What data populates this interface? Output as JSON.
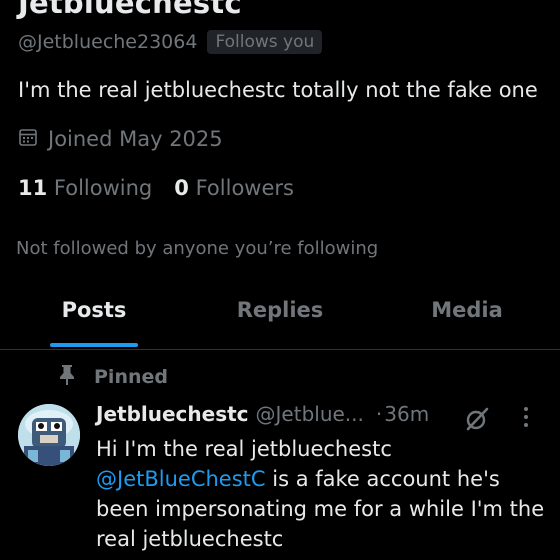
{
  "profile": {
    "display_name": "Jetbluechestc",
    "handle": "@Jetblueche23064",
    "follows_you_label": "Follows you",
    "bio": "I'm the real jetbluechestc totally not the fake one",
    "joined": "Joined May 2025",
    "following_count": "11",
    "following_label": "Following",
    "followers_count": "0",
    "followers_label": "Followers",
    "not_followed_text": "Not followed by anyone you’re following"
  },
  "tabs": [
    {
      "label": "Posts",
      "active": true
    },
    {
      "label": "Replies",
      "active": false
    },
    {
      "label": "Media",
      "active": false
    }
  ],
  "pinned_label": "Pinned",
  "tweet": {
    "name": "Jetbluechestc",
    "handle": "@Jetblue...",
    "dot": "·",
    "time": "36m",
    "text_line1": "Hi I'm the real jetbluechestc",
    "mention": "@JetBlueChestC",
    "text_after_mention": " is a fake account he's been impersonating me for a while I'm the real jetbluechestc"
  },
  "colors": {
    "background": "#000000",
    "primary_text": "#e7e9ea",
    "secondary_text": "#71767b",
    "accent": "#1d9bf0",
    "divider": "#2f3336"
  },
  "icons": {
    "calendar": "calendar-icon",
    "pin": "pin-icon",
    "grok": "grok-icon",
    "more": "more-vertical-icon"
  }
}
